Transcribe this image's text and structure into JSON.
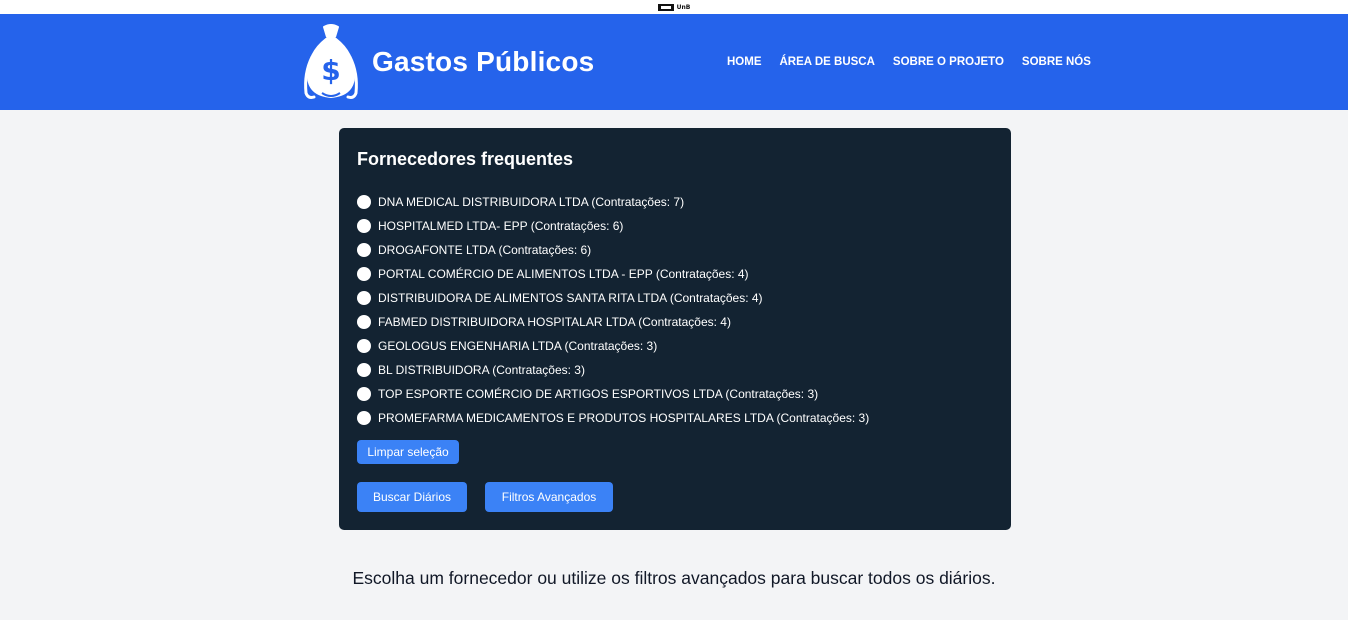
{
  "topbar": {
    "unb_text": "UnB"
  },
  "header": {
    "logo_icon": "money-bag-icon",
    "title": "Gastos Públicos",
    "nav": [
      {
        "label": "HOME"
      },
      {
        "label": "ÁREA DE BUSCA"
      },
      {
        "label": "SOBRE O PROJETO"
      },
      {
        "label": "SOBRE NÓS"
      }
    ]
  },
  "card": {
    "title": "Fornecedores frequentes",
    "suppliers": [
      {
        "label": "DNA MEDICAL DISTRIBUIDORA LTDA (Contratações: 7)"
      },
      {
        "label": "HOSPITALMED LTDA- EPP (Contratações: 6)"
      },
      {
        "label": "DROGAFONTE LTDA (Contratações: 6)"
      },
      {
        "label": "PORTAL COMÉRCIO DE ALIMENTOS LTDA - EPP (Contratações: 4)"
      },
      {
        "label": "DISTRIBUIDORA DE ALIMENTOS SANTA RITA LTDA (Contratações: 4)"
      },
      {
        "label": "FABMED DISTRIBUIDORA HOSPITALAR LTDA (Contratações: 4)"
      },
      {
        "label": "GEOLOGUS ENGENHARIA LTDA (Contratações: 3)"
      },
      {
        "label": "BL DISTRIBUIDORA (Contratações: 3)"
      },
      {
        "label": "TOP ESPORTE COMÉRCIO DE ARTIGOS ESPORTIVOS LTDA (Contratações: 3)"
      },
      {
        "label": "PROMEFARMA MEDICAMENTOS E PRODUTOS HOSPITALARES LTDA (Contratações: 3)"
      }
    ],
    "clear_label": "Limpar seleção",
    "search_label": "Buscar Diários",
    "advanced_label": "Filtros Avançados"
  },
  "hint": "Escolha um fornecedor ou utilize os filtros avançados para buscar todos os diários.",
  "colors": {
    "header": "#2563eb",
    "card": "#132332",
    "button": "#3b82f6",
    "background": "#f3f4f6"
  }
}
